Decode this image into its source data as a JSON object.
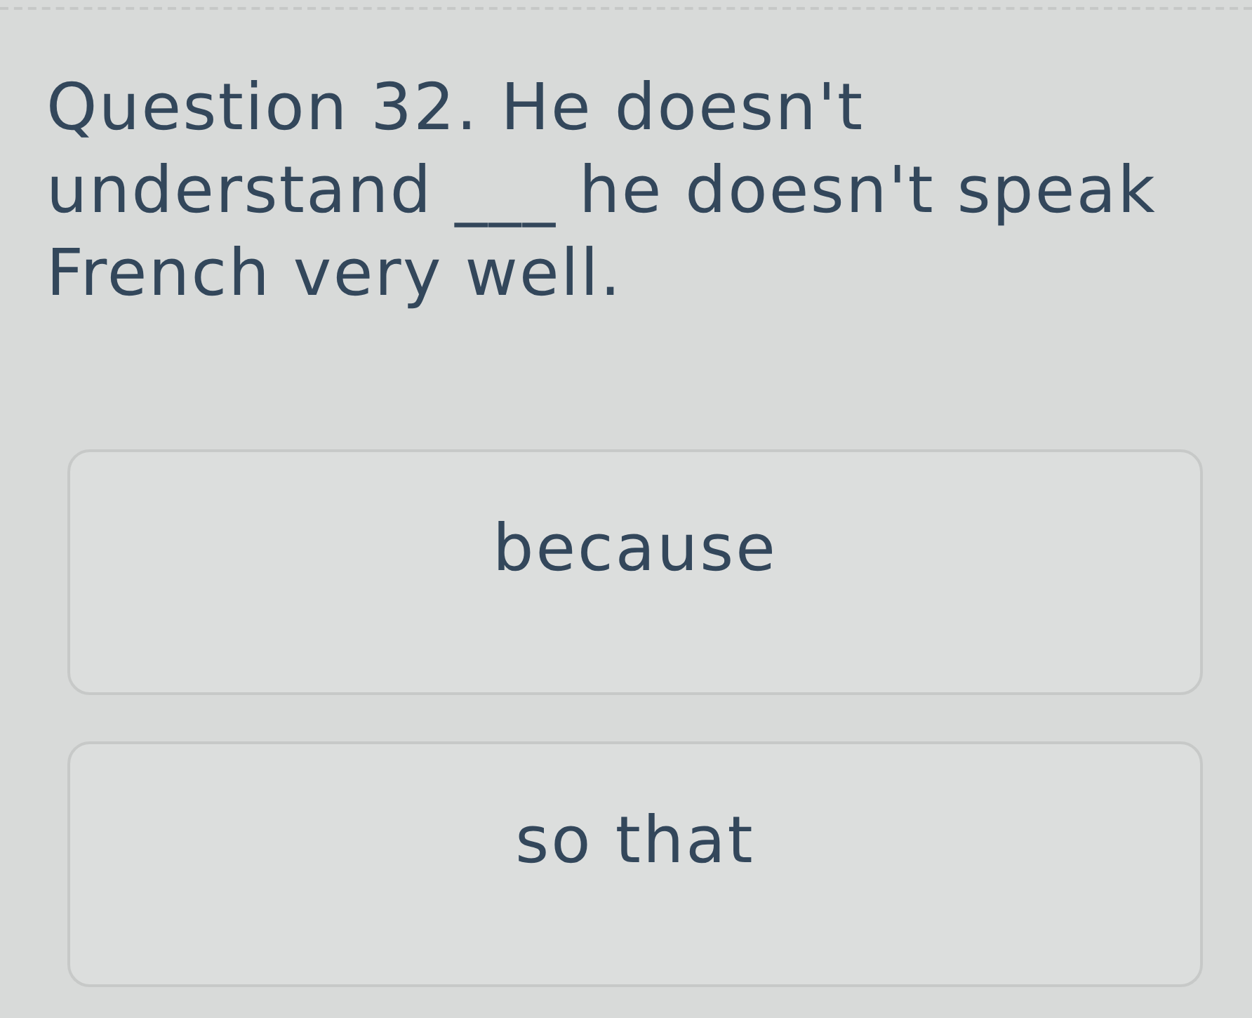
{
  "question": {
    "text": "Question 32. He doesn't understand ___ he doesn't speak French very well."
  },
  "options": [
    {
      "label": "because",
      "selected": false
    },
    {
      "label": "so that",
      "selected": false
    }
  ]
}
